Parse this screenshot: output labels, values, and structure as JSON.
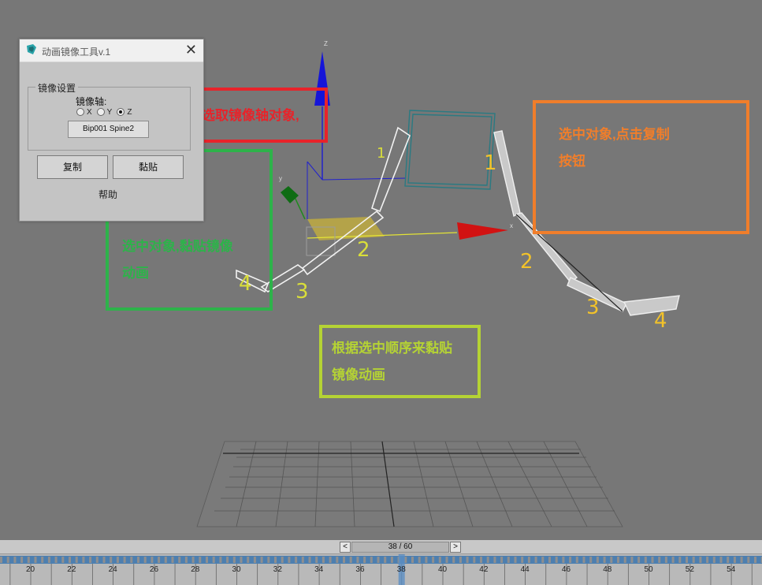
{
  "dialog": {
    "title": "动画镜像工具v.1",
    "close_glyph": "✕",
    "group_label": "镜像设置",
    "axis_label": "镜像轴:",
    "axis_options": [
      "X",
      "Y",
      "Z"
    ],
    "axis_selected": "Z",
    "pick_button": "Bip001 Spine2",
    "copy_button": "复制",
    "paste_button": "黏贴",
    "help_label": "帮助"
  },
  "annotations": {
    "red": {
      "text": "选取镜像轴对象,",
      "color": "#e8232a"
    },
    "orange": {
      "line1": "选中对象,点击复制",
      "line2": "按钮",
      "color": "#f07e2b"
    },
    "green": {
      "line1": "选中对象,黏贴镜像",
      "line2": "动画",
      "color": "#2db34a"
    },
    "lime": {
      "line1": "根据选中顺序来黏贴",
      "line2": "镜像动画",
      "color": "#b5d334"
    }
  },
  "gizmo": {
    "z_label": "Z",
    "y_label": "y",
    "x_label": "x"
  },
  "hand_labels": {
    "one_a": "1",
    "one_b": "1",
    "two_a": "2",
    "two_b": "2",
    "three_a": "3",
    "three_b": "3",
    "four_a": "4",
    "four_b": "4"
  },
  "timeline": {
    "prev": "<",
    "next": ">",
    "frame_counter": "38 / 60",
    "current_frame": 38,
    "ticks": [
      "20",
      "22",
      "24",
      "26",
      "28",
      "30",
      "32",
      "34",
      "36",
      "38",
      "40",
      "42",
      "44",
      "46",
      "48",
      "50",
      "52",
      "54"
    ]
  }
}
